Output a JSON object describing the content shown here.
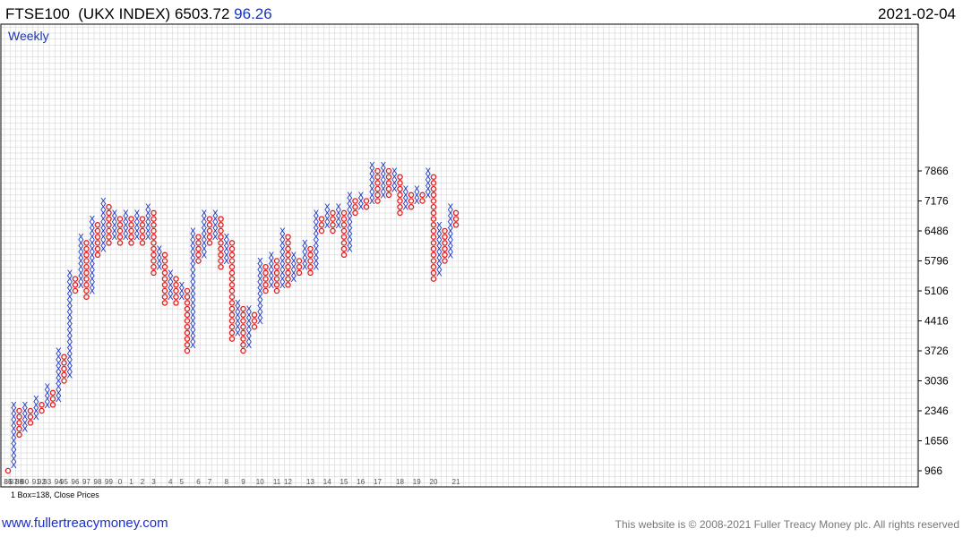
{
  "header": {
    "symbol": "FTSE100",
    "index_name": "(UKX INDEX)",
    "price": "6503.72",
    "change": "96.26",
    "date": "2021-02-04"
  },
  "footer": {
    "link": "www.fullertreacymoney.com",
    "copyright": "This website is © 2008-2021 Fuller Treacy Money plc. All rights reserved",
    "box_note": "1 Box=138, Close Prices"
  },
  "colors": {
    "x": "#1a35c5",
    "o": "#e01b1b",
    "grid": "#d6d6d6",
    "axis": "#000000"
  },
  "chart_data": {
    "type": "point-and-figure",
    "timeframe_label": "Weekly",
    "box_size": 138,
    "price_basis": "Close Prices",
    "y_axis_side": "right",
    "y_ticks": [
      966,
      1656,
      2346,
      3036,
      3726,
      4416,
      5106,
      5796,
      6486,
      7176,
      7866
    ],
    "grid": true,
    "x_labels": [
      "85",
      "86",
      "87",
      "88",
      "89",
      "90",
      "91",
      "92",
      "93",
      "94",
      "95",
      "96",
      "97",
      "98",
      "99",
      "0",
      "1",
      "2",
      "3",
      "4",
      "5",
      "6",
      "7",
      "8",
      "9",
      "10",
      "11",
      "12",
      "13",
      "14",
      "15",
      "16",
      "17",
      "18",
      "19",
      "20",
      "21"
    ],
    "columns": [
      {
        "type": "O",
        "from": 966,
        "to": 966
      },
      {
        "type": "X",
        "from": 1104,
        "to": 2484
      },
      {
        "type": "O",
        "from": 2346,
        "to": 1794
      },
      {
        "type": "X",
        "from": 1932,
        "to": 2484
      },
      {
        "type": "O",
        "from": 2346,
        "to": 2070
      },
      {
        "type": "X",
        "from": 2208,
        "to": 2622
      },
      {
        "type": "O",
        "from": 2484,
        "to": 2346
      },
      {
        "type": "X",
        "from": 2484,
        "to": 2898
      },
      {
        "type": "O",
        "from": 2760,
        "to": 2484
      },
      {
        "type": "X",
        "from": 2622,
        "to": 3726
      },
      {
        "type": "O",
        "from": 3588,
        "to": 3036
      },
      {
        "type": "X",
        "from": 3174,
        "to": 5520
      },
      {
        "type": "O",
        "from": 5382,
        "to": 5106
      },
      {
        "type": "X",
        "from": 5244,
        "to": 6348
      },
      {
        "type": "O",
        "from": 6210,
        "to": 4968
      },
      {
        "type": "X",
        "from": 5106,
        "to": 6762
      },
      {
        "type": "O",
        "from": 6624,
        "to": 5934
      },
      {
        "type": "X",
        "from": 6072,
        "to": 7176
      },
      {
        "type": "O",
        "from": 7038,
        "to": 6210
      },
      {
        "type": "X",
        "from": 6348,
        "to": 6900
      },
      {
        "type": "O",
        "from": 6762,
        "to": 6210
      },
      {
        "type": "X",
        "from": 6348,
        "to": 6900
      },
      {
        "type": "O",
        "from": 6762,
        "to": 6210
      },
      {
        "type": "X",
        "from": 6348,
        "to": 6900
      },
      {
        "type": "O",
        "from": 6762,
        "to": 6210
      },
      {
        "type": "X",
        "from": 6348,
        "to": 7038
      },
      {
        "type": "O",
        "from": 6900,
        "to": 5520
      },
      {
        "type": "X",
        "from": 5658,
        "to": 6072
      },
      {
        "type": "O",
        "from": 5934,
        "to": 4830
      },
      {
        "type": "X",
        "from": 4968,
        "to": 5520
      },
      {
        "type": "O",
        "from": 5382,
        "to": 4830
      },
      {
        "type": "X",
        "from": 4968,
        "to": 5244
      },
      {
        "type": "O",
        "from": 5106,
        "to": 3726
      },
      {
        "type": "X",
        "from": 3864,
        "to": 6486
      },
      {
        "type": "O",
        "from": 6348,
        "to": 5796
      },
      {
        "type": "X",
        "from": 5934,
        "to": 6900
      },
      {
        "type": "O",
        "from": 6762,
        "to": 6210
      },
      {
        "type": "X",
        "from": 6348,
        "to": 6900
      },
      {
        "type": "O",
        "from": 6762,
        "to": 5658
      },
      {
        "type": "X",
        "from": 5796,
        "to": 6348
      },
      {
        "type": "O",
        "from": 6210,
        "to": 4002
      },
      {
        "type": "X",
        "from": 4140,
        "to": 4830
      },
      {
        "type": "O",
        "from": 4692,
        "to": 3726
      },
      {
        "type": "X",
        "from": 3864,
        "to": 4692
      },
      {
        "type": "O",
        "from": 4554,
        "to": 4278
      },
      {
        "type": "X",
        "from": 4416,
        "to": 5796
      },
      {
        "type": "O",
        "from": 5658,
        "to": 5106
      },
      {
        "type": "X",
        "from": 5244,
        "to": 5934
      },
      {
        "type": "O",
        "from": 5796,
        "to": 5106
      },
      {
        "type": "X",
        "from": 5244,
        "to": 6486
      },
      {
        "type": "O",
        "from": 6348,
        "to": 5244
      },
      {
        "type": "X",
        "from": 5382,
        "to": 5934
      },
      {
        "type": "O",
        "from": 5796,
        "to": 5520
      },
      {
        "type": "X",
        "from": 5658,
        "to": 6210
      },
      {
        "type": "O",
        "from": 6072,
        "to": 5520
      },
      {
        "type": "X",
        "from": 5658,
        "to": 6900
      },
      {
        "type": "O",
        "from": 6762,
        "to": 6486
      },
      {
        "type": "X",
        "from": 6624,
        "to": 7038
      },
      {
        "type": "O",
        "from": 6900,
        "to": 6486
      },
      {
        "type": "X",
        "from": 6624,
        "to": 7038
      },
      {
        "type": "O",
        "from": 6900,
        "to": 5934
      },
      {
        "type": "X",
        "from": 6072,
        "to": 7314
      },
      {
        "type": "O",
        "from": 7176,
        "to": 6900
      },
      {
        "type": "X",
        "from": 7038,
        "to": 7314
      },
      {
        "type": "O",
        "from": 7176,
        "to": 7038
      },
      {
        "type": "X",
        "from": 7176,
        "to": 8004
      },
      {
        "type": "O",
        "from": 7866,
        "to": 7176
      },
      {
        "type": "X",
        "from": 7314,
        "to": 8004
      },
      {
        "type": "O",
        "from": 7866,
        "to": 7314
      },
      {
        "type": "X",
        "from": 7452,
        "to": 7866
      },
      {
        "type": "O",
        "from": 7728,
        "to": 6900
      },
      {
        "type": "X",
        "from": 7038,
        "to": 7452
      },
      {
        "type": "O",
        "from": 7314,
        "to": 7038
      },
      {
        "type": "X",
        "from": 7176,
        "to": 7452
      },
      {
        "type": "O",
        "from": 7314,
        "to": 7176
      },
      {
        "type": "X",
        "from": 7314,
        "to": 7866
      },
      {
        "type": "O",
        "from": 7728,
        "to": 5382
      },
      {
        "type": "X",
        "from": 5520,
        "to": 6624
      },
      {
        "type": "O",
        "from": 6486,
        "to": 5796
      },
      {
        "type": "X",
        "from": 5934,
        "to": 7038
      },
      {
        "type": "O",
        "from": 6900,
        "to": 6624
      }
    ]
  }
}
